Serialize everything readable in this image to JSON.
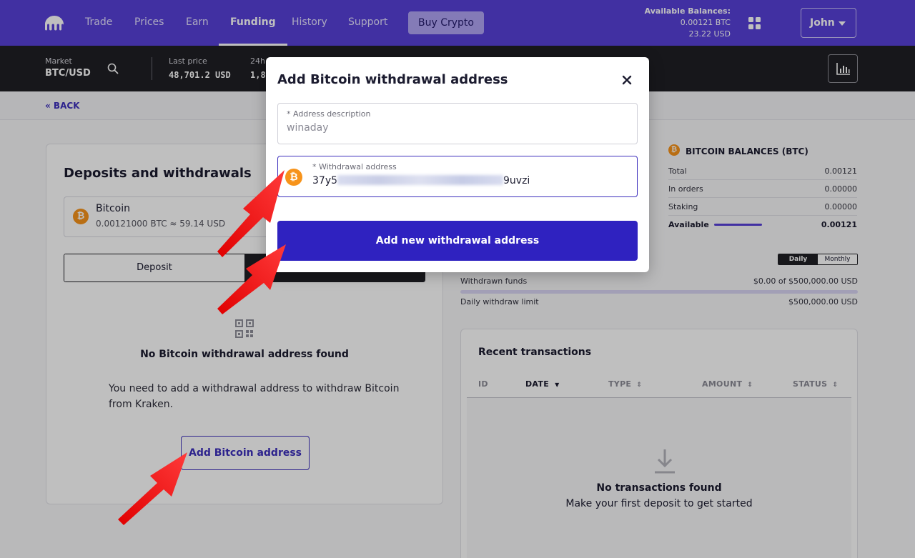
{
  "nav": {
    "items": [
      "Trade",
      "Prices",
      "Earn",
      "Funding",
      "History",
      "Support"
    ],
    "active": "Funding",
    "buy_label": "Buy Crypto",
    "balances_title": "Available Balances:",
    "balance_btc": "0.00121 BTC",
    "balance_usd": "23.22 USD",
    "user_label": "John"
  },
  "market": {
    "market_label": "Market",
    "pair": "BTC/USD",
    "last_price_label": "Last price",
    "last_price": "48,701.2 USD",
    "change_label": "24h",
    "change_value": "1,8"
  },
  "back_label": "« BACK",
  "deposits": {
    "title": "Deposits and withdrawals",
    "asset_name": "Bitcoin",
    "asset_balance": "0.00121000 BTC ≈ 59.14 USD",
    "deposit_label": "Deposit",
    "withdraw_label": "",
    "empty_title": "No Bitcoin withdrawal address found",
    "empty_desc": "You need to add a withdrawal address to withdraw Bitcoin from Kraken.",
    "add_button": "Add Bitcoin address"
  },
  "btc_balances": {
    "title": "BITCOIN BALANCES (BTC)",
    "rows": [
      {
        "label": "Total",
        "value": "0.00121"
      },
      {
        "label": "In orders",
        "value": "0.00000"
      },
      {
        "label": "Staking",
        "value": "0.00000"
      },
      {
        "label": "Available",
        "value": "0.00121"
      }
    ],
    "available_fraction": 1.0
  },
  "limits": {
    "daily_label": "Daily",
    "monthly_label": "Monthly",
    "withdrawn_label": "Withdrawn funds",
    "withdrawn_value": "$0.00 of $500,000.00 USD",
    "limit_label": "Daily withdraw limit",
    "limit_value": "$500,000.00 USD"
  },
  "transactions": {
    "title": "Recent transactions",
    "columns": [
      "ID",
      "DATE",
      "TYPE",
      "AMOUNT",
      "STATUS"
    ],
    "empty_title": "No transactions found",
    "empty_desc": "Make your first deposit to get started"
  },
  "modal": {
    "title": "Add Bitcoin withdrawal address",
    "desc_label": "* Address description",
    "desc_value": "winaday",
    "addr_label": "* Withdrawal address",
    "addr_start": "37y5",
    "addr_end": "9uvzi",
    "submit_label": "Add new withdrawal address"
  },
  "colors": {
    "brand": "#5741d9",
    "button": "#2f22c0",
    "bitcoin": "#f7931a",
    "arrow": "#ff1f1f"
  }
}
